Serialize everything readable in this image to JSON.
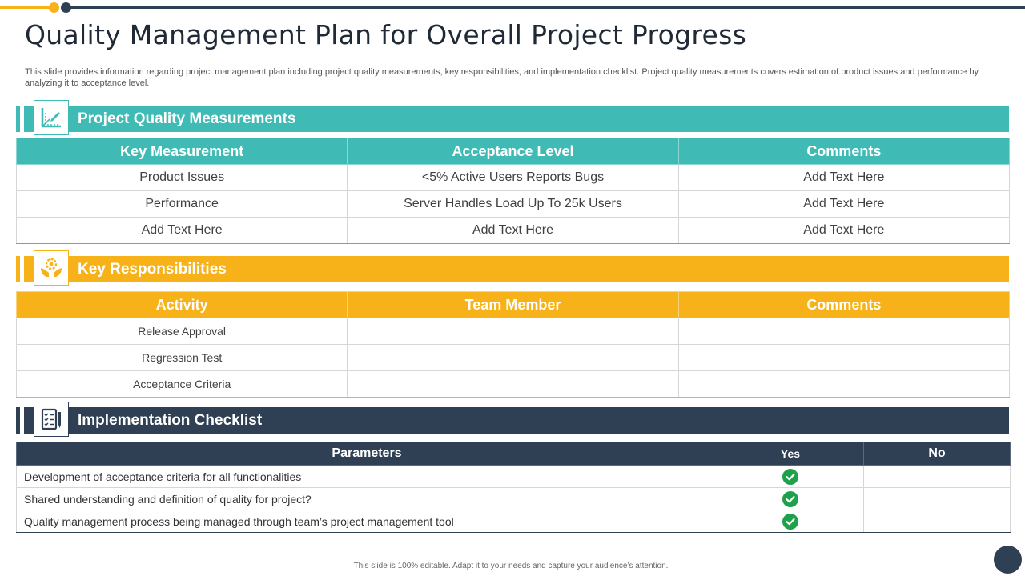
{
  "page": {
    "title": "Quality Management Plan for Overall Project Progress",
    "subtitle": "This slide provides information regarding project management plan including project quality measurements, key responsibilities, and implementation checklist. Project quality measurements covers estimation of product issues and performance by analyzing it to acceptance level.",
    "footer": "This slide is 100% editable. Adapt it to your needs and capture your audience’s attention."
  },
  "colors": {
    "teal": "#3fbab4",
    "gold": "#f7b21a",
    "navy": "#2f4054",
    "check_green": "#1ea14a"
  },
  "quality_section": {
    "title": "Project Quality Measurements",
    "icon": "ruler-pencil-icon",
    "headers": [
      "Key Measurement",
      "Acceptance Level",
      "Comments"
    ],
    "rows": [
      [
        "Product Issues",
        "<5% Active Users Reports Bugs",
        "Add Text Here"
      ],
      [
        "Performance",
        "Server Handles Load Up To 25k Users",
        "Add Text Here"
      ],
      [
        "Add Text Here",
        "Add Text Here",
        "Add Text Here"
      ]
    ]
  },
  "responsibilities_section": {
    "title": "Key Responsibilities",
    "icon": "hands-gear-icon",
    "headers": [
      "Activity",
      "Team Member",
      "Comments"
    ],
    "rows": [
      [
        "Release Approval",
        "",
        ""
      ],
      [
        "Regression Test",
        "",
        ""
      ],
      [
        "Acceptance Criteria",
        "",
        ""
      ]
    ]
  },
  "checklist_section": {
    "title": "Implementation Checklist",
    "icon": "checklist-pen-icon",
    "headers": [
      "Parameters",
      "Yes",
      "No"
    ],
    "rows": [
      {
        "parameter": "Development of acceptance criteria for all functionalities",
        "yes": true,
        "no": false
      },
      {
        "parameter": "Shared understanding and definition of quality for project?",
        "yes": true,
        "no": false
      },
      {
        "parameter": "Quality management process being managed through team’s project management tool",
        "yes": true,
        "no": false
      }
    ]
  }
}
